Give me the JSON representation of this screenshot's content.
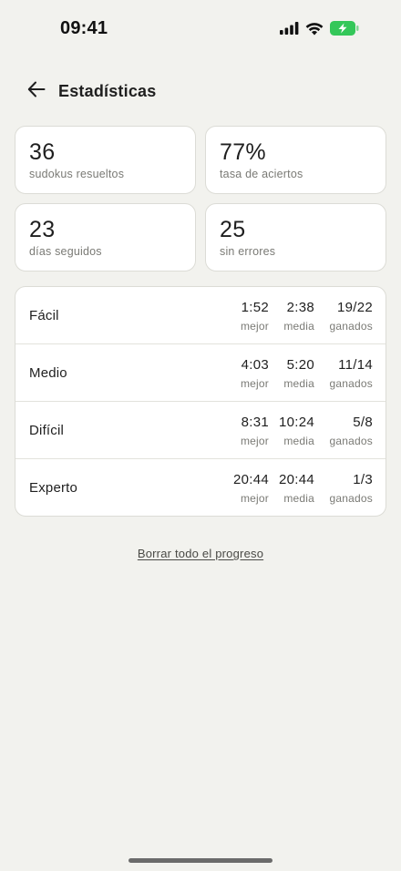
{
  "status_bar": {
    "time": "09:41",
    "battery_color": "#34c759"
  },
  "header": {
    "title": "Estadísticas"
  },
  "summary": [
    {
      "value": "36",
      "label": "sudokus resueltos"
    },
    {
      "value": "77%",
      "label": "tasa de aciertos"
    },
    {
      "value": "23",
      "label": "días seguidos"
    },
    {
      "value": "25",
      "label": "sin errores"
    }
  ],
  "difficulties": [
    {
      "name": "Fácil",
      "best": "1:52",
      "avg": "2:38",
      "won": "19/22"
    },
    {
      "name": "Medio",
      "best": "4:03",
      "avg": "5:20",
      "won": "11/14"
    },
    {
      "name": "Difícil",
      "best": "8:31",
      "avg": "10:24",
      "won": "5/8"
    },
    {
      "name": "Experto",
      "best": "20:44",
      "avg": "20:44",
      "won": "1/3"
    }
  ],
  "metric_labels": {
    "best": "mejor",
    "avg": "media",
    "won": "ganados"
  },
  "reset_label": "Borrar todo el progreso"
}
